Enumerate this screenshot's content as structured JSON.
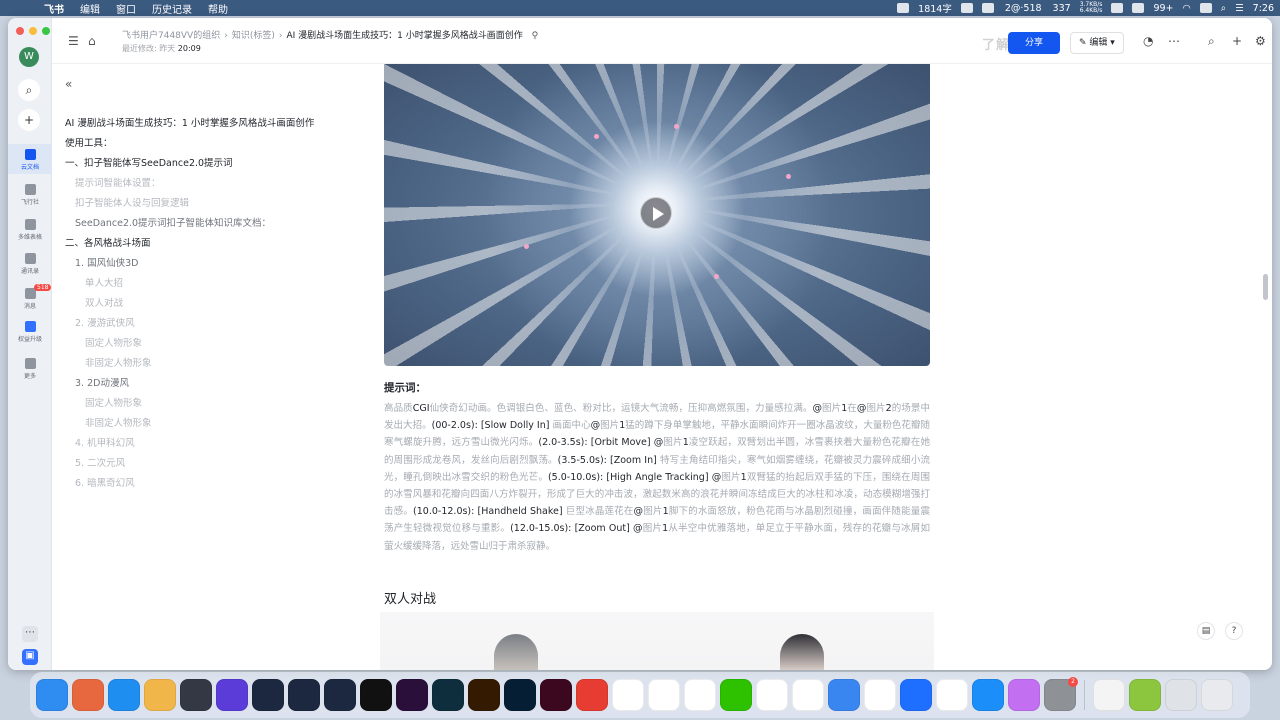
{
  "menubar": {
    "app": "飞书",
    "menus": [
      "编辑",
      "窗口",
      "历史记录",
      "帮助"
    ],
    "status": {
      "word_count": "1814字",
      "doc_status": "2@·518",
      "count": "337",
      "wechat_badge": "99+",
      "net_up": "3.7KB/s",
      "net_down": "6.4KB/s",
      "time": "7:26"
    }
  },
  "rail": {
    "avatar": "W",
    "items": [
      {
        "label": "云文档",
        "icon": "doc-icon"
      },
      {
        "label": "飞行社",
        "icon": "app-icon"
      },
      {
        "label": "多维表格",
        "icon": "table-icon"
      },
      {
        "label": "通讯录",
        "icon": "contacts-icon"
      },
      {
        "label": "消息",
        "icon": "chat-icon",
        "badge": "518"
      },
      {
        "label": "权益升级",
        "icon": "diamond-icon"
      },
      {
        "label": "更多",
        "icon": "grid-icon"
      }
    ]
  },
  "header": {
    "breadcrumbs": [
      "飞书用户7448VV的组织",
      "知识(标签)",
      "AI 漫剧战斗场面生成技巧：1 小时掌握多风格战斗画面创作"
    ],
    "edited_prefix": "最近修改: 昨天",
    "edited_time": "20:09",
    "share_label": "分享",
    "watermark": "了解更多",
    "edit_label": "编辑"
  },
  "toc": {
    "items": [
      {
        "text": "AI 漫剧战斗场面生成技巧：1 小时掌握多风格战斗画面创作",
        "style": "dark"
      },
      {
        "text": "使用工具：",
        "style": "dark"
      },
      {
        "text": "一、扣子智能体写SeeDance2.0提示词",
        "style": "dark"
      },
      {
        "text": "提示词智能体设置：",
        "style": "light"
      },
      {
        "text": "扣子智能体人设与回复逻辑",
        "style": "light"
      },
      {
        "text": "SeeDance2.0提示词扣子智能体知识库文档：",
        "style": "mixed"
      },
      {
        "text": "二、各风格战斗场面",
        "style": "dark"
      },
      {
        "text": "1. 国风仙侠3D",
        "style": "mixed"
      },
      {
        "text": "单人大招",
        "style": "light"
      },
      {
        "text": "双人对战",
        "style": "light"
      },
      {
        "text": "2. 漫游武侠风",
        "style": "light"
      },
      {
        "text": "固定人物形象",
        "style": "light"
      },
      {
        "text": "非固定人物形象",
        "style": "light"
      },
      {
        "text": "3. 2D动漫风",
        "style": "mixed"
      },
      {
        "text": "固定人物形象",
        "style": "light"
      },
      {
        "text": "非固定人物形象",
        "style": "light"
      },
      {
        "text": "4. 机甲科幻风",
        "style": "light"
      },
      {
        "text": "5. 二次元风",
        "style": "light"
      },
      {
        "text": "6. 暗黑奇幻风",
        "style": "light"
      }
    ]
  },
  "content": {
    "prompt_label": "提示词：",
    "prompt_segments": [
      {
        "t": "高品质",
        "d": false
      },
      {
        "t": "CGI",
        "d": true
      },
      {
        "t": "仙侠奇幻动画。色调银白色、蓝色、粉对比，运镜大气流畅，压抑高燃氛围，力量感拉满。",
        "d": false
      },
      {
        "t": "@",
        "d": true
      },
      {
        "t": "图片",
        "d": false
      },
      {
        "t": "1",
        "d": true
      },
      {
        "t": "在",
        "d": false
      },
      {
        "t": "@",
        "d": true
      },
      {
        "t": "图片",
        "d": false
      },
      {
        "t": "2",
        "d": true
      },
      {
        "t": "的场景中发出大招。",
        "d": false
      },
      {
        "t": "(00-2.0s): [Slow Dolly In]",
        "d": true
      },
      {
        "t": " 画面中心",
        "d": false
      },
      {
        "t": "@",
        "d": true
      },
      {
        "t": "图片",
        "d": false
      },
      {
        "t": "1",
        "d": true
      },
      {
        "t": "猛的蹲下身单掌触地，平静水面瞬间炸开一圈冰晶波纹，大量粉色花瓣随寒气螺旋升腾，远方雪山微光闪烁。",
        "d": false
      },
      {
        "t": "(2.0-3.5s): [Orbit Move] @",
        "d": true
      },
      {
        "t": "图片",
        "d": false
      },
      {
        "t": "1",
        "d": true
      },
      {
        "t": "凌空跃起，双臂划出半圆，冰雪裹挟着大量粉色花瓣在她的周围形成龙卷风，发丝向后剧烈飘荡。",
        "d": false
      },
      {
        "t": "(3.5-5.0s): [Zoom In]",
        "d": true
      },
      {
        "t": " 特写主角结印指尖，寒气如烟雾缠绕，花瓣被灵力震碎成细小流光，瞳孔倒映出冰雪交织的粉色光芒。",
        "d": false
      },
      {
        "t": "(5.0-10.0s): [High Angle Tracking] @",
        "d": true
      },
      {
        "t": "图片",
        "d": false
      },
      {
        "t": "1",
        "d": true
      },
      {
        "t": "双臂猛的抬起后双手猛的下压，围绕在周围的冰雪风暴和花瓣向四面八方炸裂开，形成了巨大的冲击波，激起数米高的浪花并瞬间冻结成巨大的冰柱和冰凌，动态模糊增强打击感。",
        "d": false
      },
      {
        "t": "(10.0-12.0s): [Handheld Shake]",
        "d": true
      },
      {
        "t": " 巨型冰晶莲花在",
        "d": false
      },
      {
        "t": "@",
        "d": true
      },
      {
        "t": "图片",
        "d": false
      },
      {
        "t": "1",
        "d": true
      },
      {
        "t": "脚下的水面怒放，粉色花雨与冰晶剧烈碰撞，画面伴随能量震荡产生轻微视觉位移与重影。",
        "d": false
      },
      {
        "t": "(12.0-15.0s): [Zoom Out] @",
        "d": true
      },
      {
        "t": "图片",
        "d": false
      },
      {
        "t": "1",
        "d": true
      },
      {
        "t": "从半空中优雅落地，单足立于平静水面，残存的花瓣与冰屑如萤火缓缓降落，远处雪山归于肃杀寂静。",
        "d": false
      }
    ],
    "section_heading": "双人对战"
  },
  "dock": {
    "apps": [
      {
        "name": "finder",
        "color": "#2f8cf0"
      },
      {
        "name": "launchpad",
        "color": "#e7683f"
      },
      {
        "name": "safari",
        "color": "#1f8ef1"
      },
      {
        "name": "photos",
        "color": "#f1b64a"
      },
      {
        "name": "davinci",
        "color": "#333844"
      },
      {
        "name": "video-app",
        "color": "#5b3cd8"
      },
      {
        "name": "c4d-1",
        "color": "#1b2840"
      },
      {
        "name": "c4d-2",
        "color": "#1b2840"
      },
      {
        "name": "c4d-3",
        "color": "#1b2840"
      },
      {
        "name": "capcut",
        "color": "#111111"
      },
      {
        "name": "premiere",
        "color": "#2a0f3b"
      },
      {
        "name": "audition",
        "color": "#0e2e3e"
      },
      {
        "name": "illustrator",
        "color": "#331a00"
      },
      {
        "name": "photoshop",
        "color": "#061e33"
      },
      {
        "name": "indesign",
        "color": "#3b0820"
      },
      {
        "name": "xmind",
        "color": "#e63c31"
      },
      {
        "name": "wps",
        "color": "#ffffff"
      },
      {
        "name": "baidu-netdisk",
        "color": "#ffffff"
      },
      {
        "name": "lark",
        "color": "#ffffff"
      },
      {
        "name": "wechat",
        "color": "#2dc100"
      },
      {
        "name": "qq",
        "color": "#ffffff"
      },
      {
        "name": "quark",
        "color": "#ffffff"
      },
      {
        "name": "screen-tool",
        "color": "#3a86f0"
      },
      {
        "name": "feishu-meeting",
        "color": "#ffffff"
      },
      {
        "name": "tencent-meeting",
        "color": "#1e6fff"
      },
      {
        "name": "chrome",
        "color": "#ffffff"
      },
      {
        "name": "app-store",
        "color": "#1c8ef9"
      },
      {
        "name": "qq-music-cat",
        "color": "#c36ff2"
      },
      {
        "name": "system-settings",
        "color": "#8e9196",
        "badge": "2"
      },
      {
        "name": "notes",
        "color": "#f4f4f4"
      },
      {
        "name": "doc-viewer",
        "color": "#8cc63f"
      },
      {
        "name": "screenshot",
        "color": "#dfe3e8"
      },
      {
        "name": "trash",
        "color": "#e8eaee"
      }
    ]
  }
}
